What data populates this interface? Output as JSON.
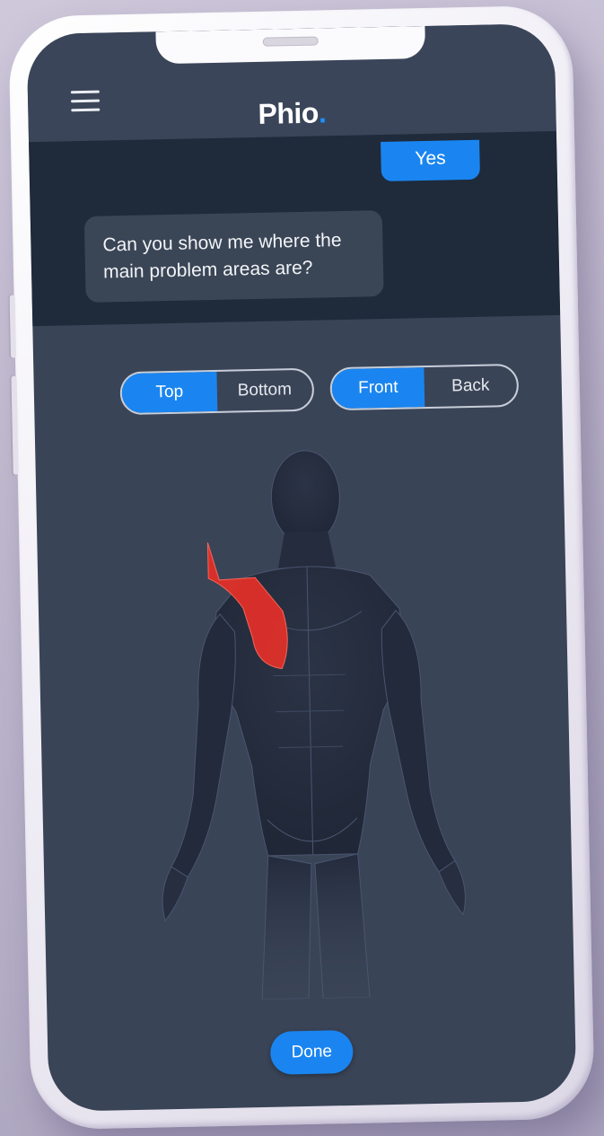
{
  "app": {
    "title": "Phio",
    "title_dot": "."
  },
  "chat": {
    "reply": "Yes",
    "question": "Can you show me where the main problem areas are?"
  },
  "toggles": {
    "region": {
      "options": [
        "Top",
        "Bottom"
      ],
      "selected": "Top"
    },
    "view": {
      "options": [
        "Front",
        "Back"
      ],
      "selected": "Front"
    }
  },
  "body_map": {
    "selected_area": "right-shoulder-trapezius",
    "highlight_color": "#e0302a"
  },
  "actions": {
    "done": "Done"
  },
  "colors": {
    "accent": "#1a85f0",
    "screen_bg": "#3a4457",
    "chat_bg": "#1f2a3b"
  },
  "icons": {
    "menu": "hamburger-menu-icon"
  }
}
